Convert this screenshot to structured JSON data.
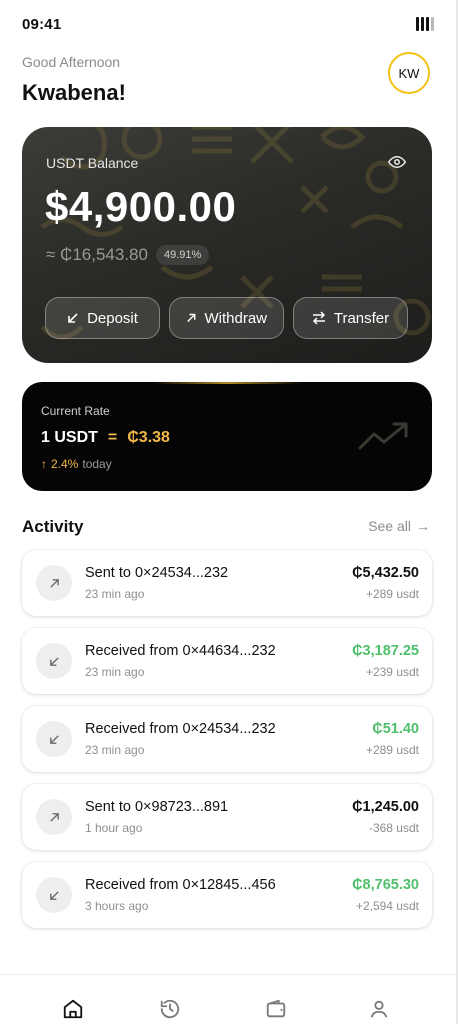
{
  "status_bar": {
    "time": "09:41"
  },
  "header": {
    "greeting": "Good Afternoon",
    "name": "Kwabena!",
    "avatar_initials": "KW"
  },
  "balance_card": {
    "label": "USDT Balance",
    "amount": "$4,900.00",
    "local_amount": "≈ ₵16,543.80",
    "percent": "49.91%",
    "actions": {
      "deposit": "Deposit",
      "withdraw": "Withdraw",
      "transfer": "Transfer"
    }
  },
  "rate_card": {
    "label": "Current Rate",
    "base": "1 USDT",
    "equals": "=",
    "value": "₵3.38",
    "change": "2.4%",
    "change_suffix": "today"
  },
  "activity": {
    "title": "Activity",
    "see_all": "See all",
    "items": [
      {
        "title": "Sent to 0×24534...232",
        "time": "23 min ago",
        "amount": "₵5,432.50",
        "usdt": "+289 usdt",
        "direction": "sent"
      },
      {
        "title": "Received from 0×44634...232",
        "time": "23 min ago",
        "amount": "₵3,187.25",
        "usdt": "+239 usdt",
        "direction": "received"
      },
      {
        "title": "Received from 0×24534...232",
        "time": "23 min ago",
        "amount": "₵51.40",
        "usdt": "+289 usdt",
        "direction": "received"
      },
      {
        "title": "Sent to 0×98723...891",
        "time": "1 hour ago",
        "amount": "₵1,245.00",
        "usdt": "-368 usdt",
        "direction": "sent"
      },
      {
        "title": "Received from 0×12845...456",
        "time": "3 hours ago",
        "amount": "₵8,765.30",
        "usdt": "+2,594 usdt",
        "direction": "received"
      }
    ]
  },
  "bottom_nav": {
    "items": [
      "home-icon",
      "history-icon",
      "wallet-icon",
      "profile-icon"
    ],
    "active": "home-icon"
  },
  "colors": {
    "accent_gold": "#f2b84b",
    "received_green": "#4fbf6c",
    "avatar_ring": "#f2c21a"
  }
}
